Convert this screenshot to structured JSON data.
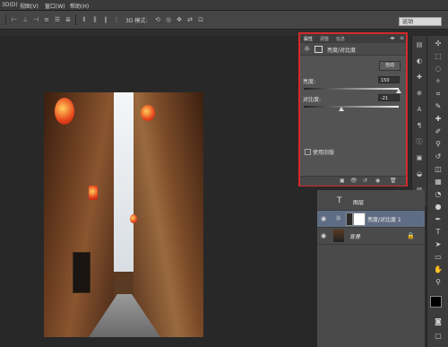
{
  "menubar": {
    "items": [
      "3D(D)",
      "视图(V)",
      "窗口(W)",
      "帮助(H)"
    ]
  },
  "optionsbar": {
    "mode_label": "3D 模式:",
    "workspace": "运动"
  },
  "properties_panel": {
    "tabs": [
      "属性",
      "调整",
      "信息"
    ],
    "title": "亮度/对比度",
    "auto_button": "自动",
    "brightness_label": "亮度:",
    "brightness_value": "150",
    "brightness_fraction": 1.0,
    "contrast_label": "对比度:",
    "contrast_value": "-21",
    "contrast_fraction": 0.4,
    "legacy_label": "使用旧版"
  },
  "layers": [
    {
      "name": "图层",
      "type": "text"
    },
    {
      "name": "亮度/对比度 1",
      "type": "adjustment",
      "selected": true
    },
    {
      "name": "背景",
      "type": "background"
    }
  ],
  "colors": {
    "highlight_border": "#d42a2a",
    "selected_layer": "#5f6d84"
  }
}
